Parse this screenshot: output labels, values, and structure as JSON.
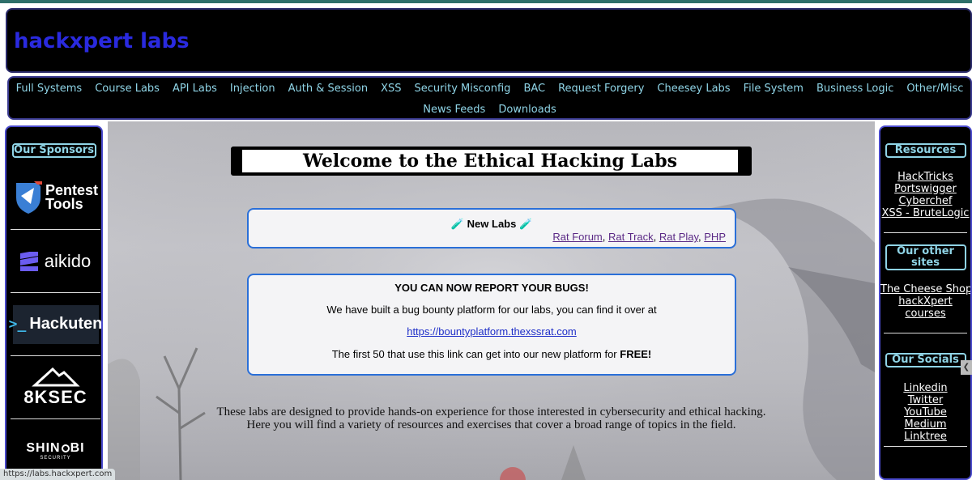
{
  "header": {
    "title": "hackxpert labs"
  },
  "nav": {
    "row1": [
      "Full Systems",
      "Course Labs",
      "API Labs",
      "Injection",
      "Auth & Session",
      "XSS",
      "Security Misconfig",
      "BAC",
      "Request Forgery",
      "Cheesey Labs",
      "File System",
      "Business Logic",
      "Other/Misc"
    ],
    "row2": [
      "News Feeds",
      "Downloads"
    ]
  },
  "left_sidebar": {
    "title": "Our Sponsors",
    "sponsors": [
      {
        "name": "Pentest Tools",
        "line1": "Pentest",
        "line2": "Tools"
      },
      {
        "name": "aikido",
        "text": "aikido"
      },
      {
        "name": "Hackuten",
        "text": "Hackuten"
      },
      {
        "name": "8KSEC",
        "text": "8KSEC"
      },
      {
        "name": "SHINOBI",
        "text": "SHIN",
        "text2": "BI",
        "sub": "SECURITY"
      }
    ]
  },
  "main": {
    "welcome": "Welcome to the Ethical Hacking Labs",
    "new_labs": {
      "heading": "🧪 New Labs 🧪",
      "links": [
        "Rat Forum",
        "Rat Track",
        "Rat Play",
        "PHP"
      ]
    },
    "bugs": {
      "title": "YOU CAN NOW REPORT YOUR BUGS!",
      "line2": "We have built a bug bounty platform for our labs, you can find it over at",
      "link": "https://bountyplatform.thexssrat.com",
      "line4_prefix": "The first 50 that use this link can get into our new platform for ",
      "line4_bold": "FREE!"
    },
    "intro_line1": "These labs are designed to provide hands-on experience for those interested in cybersecurity and ethical hacking.",
    "intro_line2": "Here you will find a variety of resources and exercises that cover a broad range of topics in the field."
  },
  "right_sidebar": {
    "resources_title": "Resources",
    "resources": [
      "HackTricks",
      "Portswigger",
      "Cyberchef",
      "XSS - BruteLogic"
    ],
    "other_title": "Our other sites",
    "other": [
      "The Cheese Shop",
      "hackXpert",
      "courses"
    ],
    "socials_title": "Our Socials",
    "socials": [
      "Linkedin",
      "Twitter",
      "YouTube",
      "Medium",
      "Linktree"
    ]
  },
  "statusbar": {
    "url": "https://labs.hackxpert.com"
  },
  "colors": {
    "brand": "#2a2adf",
    "nav_text": "#8fd4e6",
    "box_border": "#2a6fd8"
  }
}
